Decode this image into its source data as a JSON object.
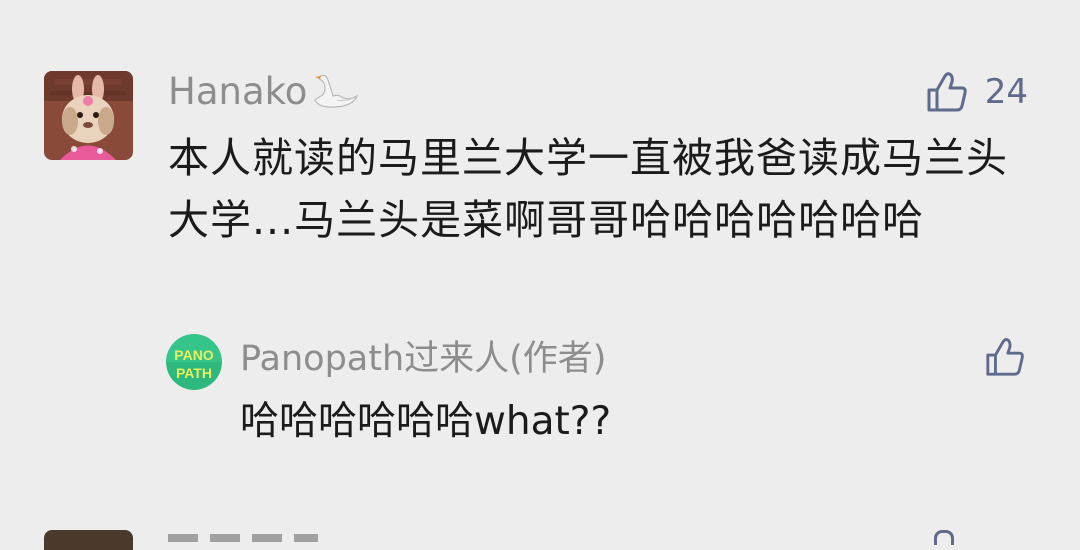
{
  "comment": {
    "username": "Hanako",
    "badge_icon": "swan-icon",
    "likes": "24",
    "text": "本人就读的马里兰大学一直被我爸读成马兰头大学...马兰头是菜啊哥哥哈哈哈哈哈哈哈"
  },
  "reply": {
    "username": "Panopath过来人(作者)",
    "avatar_text_top": "PANO",
    "avatar_text_bottom": "PATH",
    "text": "哈哈哈哈哈哈what??"
  },
  "colors": {
    "background": "#ededed",
    "username": "#8d8d8d",
    "like": "#5f6b8c",
    "text": "#1b1b1b",
    "reply_avatar_green": "#2db87d"
  }
}
